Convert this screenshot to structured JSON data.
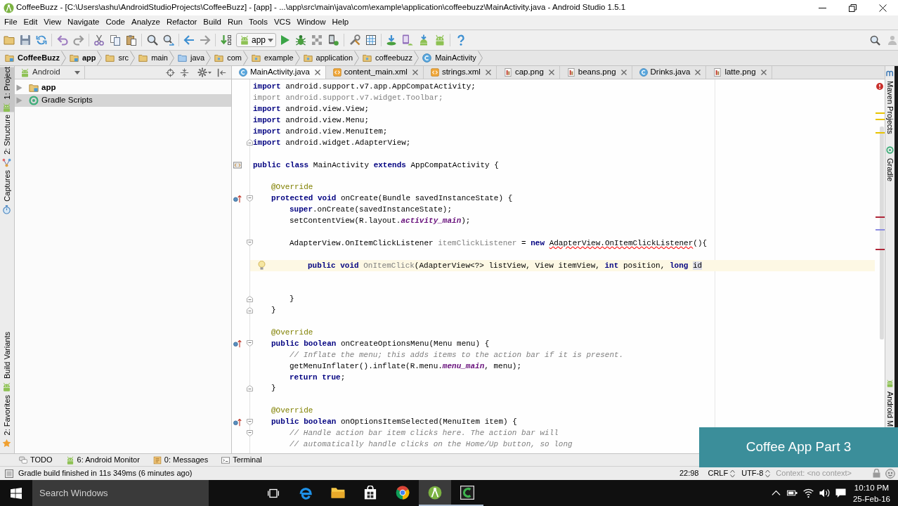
{
  "window": {
    "title": "CoffeeBuzz - [C:\\Users\\ashu\\AndroidStudioProjects\\CoffeeBuzz] - [app] - ...\\app\\src\\main\\java\\com\\example\\application\\coffeebuzz\\MainActivity.java - Android Studio 1.5.1"
  },
  "menu": [
    "File",
    "Edit",
    "View",
    "Navigate",
    "Code",
    "Analyze",
    "Refactor",
    "Build",
    "Run",
    "Tools",
    "VCS",
    "Window",
    "Help"
  ],
  "toolbar": {
    "run_configuration": "app"
  },
  "breadcrumbs": [
    {
      "label": "CoffeeBuzz",
      "kind": "project"
    },
    {
      "label": "app",
      "kind": "module"
    },
    {
      "label": "src",
      "kind": "folder"
    },
    {
      "label": "main",
      "kind": "folder"
    },
    {
      "label": "java",
      "kind": "source"
    },
    {
      "label": "com",
      "kind": "package"
    },
    {
      "label": "example",
      "kind": "package"
    },
    {
      "label": "application",
      "kind": "package"
    },
    {
      "label": "coffeebuzz",
      "kind": "package"
    },
    {
      "label": "MainActivity",
      "kind": "class"
    }
  ],
  "left_stripe": {
    "top": [
      {
        "label": "1: Project",
        "kind": "android",
        "selected": true
      },
      {
        "label": "2: Structure",
        "kind": "structure",
        "selected": false
      },
      {
        "label": "Captures",
        "kind": "captures",
        "selected": false
      }
    ],
    "bottom": [
      {
        "label": "Build Variants",
        "kind": "android",
        "selected": false
      },
      {
        "label": "2: Favorites",
        "kind": "favorites",
        "selected": false
      }
    ]
  },
  "project_panel": {
    "view": "Android",
    "tree": [
      {
        "label": "app",
        "kind": "module",
        "expanded": false,
        "selected": false
      },
      {
        "label": "Gradle Scripts",
        "kind": "gradle",
        "expanded": false,
        "selected": true
      }
    ]
  },
  "editor_tabs": [
    {
      "label": "MainActivity.java",
      "kind": "class",
      "selected": true
    },
    {
      "label": "content_main.xml",
      "kind": "xml",
      "selected": false
    },
    {
      "label": "strings.xml",
      "kind": "xml",
      "selected": false
    },
    {
      "label": "cap.png",
      "kind": "image",
      "selected": false
    },
    {
      "label": "beans.png",
      "kind": "image",
      "selected": false
    },
    {
      "label": "Drinks.java",
      "kind": "class",
      "selected": false
    },
    {
      "label": "latte.png",
      "kind": "image",
      "selected": false
    }
  ],
  "editor": {
    "lines": [
      {
        "current": false,
        "segments": [
          {
            "text": "import",
            "kind": "keyword"
          },
          {
            "text": " android.support.v7.app.AppCompatActivity;",
            "kind": "plain"
          }
        ]
      },
      {
        "current": false,
        "segments": [
          {
            "text": "import android.support.v7.widget.Toolbar;",
            "kind": "unused"
          }
        ]
      },
      {
        "current": false,
        "segments": [
          {
            "text": "import",
            "kind": "keyword"
          },
          {
            "text": " android.view.View;",
            "kind": "plain"
          }
        ]
      },
      {
        "current": false,
        "segments": [
          {
            "text": "import",
            "kind": "keyword"
          },
          {
            "text": " android.view.Menu;",
            "kind": "plain"
          }
        ]
      },
      {
        "current": false,
        "segments": [
          {
            "text": "import",
            "kind": "keyword"
          },
          {
            "text": " android.view.MenuItem;",
            "kind": "plain"
          }
        ]
      },
      {
        "current": false,
        "fold_marker": {
          "kind": "end"
        },
        "segments": [
          {
            "text": "import",
            "kind": "keyword"
          },
          {
            "text": " android.widget.AdapterView;",
            "kind": "plain"
          }
        ]
      },
      {
        "current": false
      },
      {
        "current": false,
        "gutter_icon": {
          "kind": "layout"
        },
        "segments": [
          {
            "text": "public class",
            "kind": "keyword"
          },
          {
            "text": " MainActivity ",
            "kind": "plain"
          },
          {
            "text": "extends",
            "kind": "keyword"
          },
          {
            "text": " AppCompatActivity {",
            "kind": "plain"
          }
        ],
        "children": [
          {
            "current": false
          },
          {
            "current": false,
            "segments": [
              {
                "text": "@Override",
                "kind": "annotation"
              }
            ]
          },
          {
            "current": false,
            "gutter_icon": {
              "kind": "override"
            },
            "fold_marker": {
              "kind": "start"
            },
            "segments": [
              {
                "text": "protected void",
                "kind": "keyword"
              },
              {
                "text": " onCreate(Bundle savedInstanceState) {",
                "kind": "plain"
              }
            ],
            "children": [
              {
                "current": false,
                "segments": [
                  {
                    "text": "super",
                    "kind": "keyword"
                  },
                  {
                    "text": ".onCreate(savedInstanceState);",
                    "kind": "plain"
                  }
                ]
              },
              {
                "current": false,
                "segments": [
                  {
                    "text": "setContentView(R.layout.",
                    "kind": "plain"
                  },
                  {
                    "text": "activity_main",
                    "kind": "field"
                  },
                  {
                    "text": ");",
                    "kind": "plain"
                  }
                ]
              },
              {
                "current": false
              },
              {
                "current": false,
                "fold_marker": {
                  "kind": "start"
                },
                "segments": [
                  {
                    "text": "AdapterView.OnItemClickListener ",
                    "kind": "plain"
                  },
                  {
                    "text": "itemClickListener",
                    "kind": "unused"
                  },
                  {
                    "text": " = ",
                    "kind": "plain"
                  },
                  {
                    "text": "new ",
                    "kind": "keyword"
                  },
                  {
                    "text": "AdapterView.OnItemClickListener",
                    "kind": "error"
                  },
                  {
                    "text": "(){",
                    "kind": "plain"
                  }
                ],
                "children": [
                  {
                    "current": false
                  },
                  {
                    "current": true,
                    "gutter_icon": {
                      "kind": "bulb"
                    },
                    "segments": [
                      {
                        "text": "public void ",
                        "kind": "keyword"
                      },
                      {
                        "text": "OnItemClick",
                        "kind": "unused"
                      },
                      {
                        "text": "(AdapterView<?> listView, View itemView, ",
                        "kind": "plain"
                      },
                      {
                        "text": "int",
                        "kind": "keyword"
                      },
                      {
                        "text": " position, ",
                        "kind": "plain"
                      },
                      {
                        "text": "long ",
                        "kind": "keyword"
                      },
                      {
                        "text": "id",
                        "kind": "highlighted"
                      }
                    ]
                  },
                  {
                    "current": false
                  },
                  {
                    "current": false
                  }
                ]
              },
              {
                "current": false,
                "fold_marker": {
                  "kind": "end"
                },
                "segments": [
                  {
                    "text": "}",
                    "kind": "plain"
                  }
                ]
              }
            ]
          },
          {
            "current": false,
            "fold_marker": {
              "kind": "end"
            },
            "segments": [
              {
                "text": "}",
                "kind": "plain"
              }
            ]
          },
          {
            "current": false
          },
          {
            "current": false,
            "segments": [
              {
                "text": "@Override",
                "kind": "annotation"
              }
            ]
          },
          {
            "current": false,
            "gutter_icon": {
              "kind": "override"
            },
            "fold_marker": {
              "kind": "start"
            },
            "segments": [
              {
                "text": "public boolean",
                "kind": "keyword"
              },
              {
                "text": " onCreateOptionsMenu(Menu menu) {",
                "kind": "plain"
              }
            ],
            "children": [
              {
                "current": false,
                "segments": [
                  {
                    "text": "// Inflate the menu; this adds items to the action bar if it is present.",
                    "kind": "comment"
                  }
                ]
              },
              {
                "current": false,
                "segments": [
                  {
                    "text": "getMenuInflater().inflate(R.menu.",
                    "kind": "plain"
                  },
                  {
                    "text": "menu_main",
                    "kind": "field"
                  },
                  {
                    "text": ", menu);",
                    "kind": "plain"
                  }
                ]
              },
              {
                "current": false,
                "segments": [
                  {
                    "text": "return true",
                    "kind": "keyword"
                  },
                  {
                    "text": ";",
                    "kind": "plain"
                  }
                ]
              }
            ]
          },
          {
            "current": false,
            "fold_marker": {
              "kind": "end"
            },
            "segments": [
              {
                "text": "}",
                "kind": "plain"
              }
            ]
          },
          {
            "current": false
          },
          {
            "current": false,
            "segments": [
              {
                "text": "@Override",
                "kind": "annotation"
              }
            ]
          },
          {
            "current": false,
            "gutter_icon": {
              "kind": "override"
            },
            "fold_marker": {
              "kind": "start"
            },
            "segments": [
              {
                "text": "public boolean",
                "kind": "keyword"
              },
              {
                "text": " onOptionsItemSelected(MenuItem item) {",
                "kind": "plain"
              }
            ],
            "children": [
              {
                "current": false,
                "fold_marker": {
                  "kind": "start"
                },
                "segments": [
                  {
                    "text": "// Handle action bar item clicks here. The action bar will",
                    "kind": "comment"
                  }
                ]
              },
              {
                "current": false,
                "segments": [
                  {
                    "text": "// automatically handle clicks on the Home/Up button, so long",
                    "kind": "comment"
                  }
                ]
              }
            ]
          }
        ]
      }
    ]
  },
  "right_stripe": {
    "top": [
      {
        "label": "Maven Projects",
        "kind": "maven"
      },
      {
        "label": "Gradle",
        "kind": "gradle"
      }
    ],
    "bottom": [
      {
        "label": "Android M",
        "kind": "android"
      }
    ]
  },
  "tool_tabs": [
    {
      "label": "TODO",
      "kind": "todo"
    },
    {
      "label": "6: Android Monitor",
      "kind": "android"
    },
    {
      "label": "0: Messages",
      "kind": "messages"
    },
    {
      "label": "Terminal",
      "kind": "terminal"
    }
  ],
  "status_bar": {
    "message": "Gradle build finished in 11s 349ms (6 minutes ago)",
    "position": "22:98",
    "line_separator": "CRLF",
    "encoding": "UTF-8",
    "context": "Context: <no context>"
  },
  "banner": {
    "text": "Coffee App Part 3"
  },
  "taskbar": {
    "search": {
      "placeholder": "Search Windows"
    },
    "apps": [
      {
        "kind": "browser",
        "selected": false,
        "running": false
      },
      {
        "kind": "files",
        "selected": false,
        "running": false
      },
      {
        "kind": "store",
        "selected": false,
        "running": false
      },
      {
        "kind": "chrome",
        "selected": false,
        "running": false
      },
      {
        "kind": "studio",
        "selected": true,
        "running": true
      },
      {
        "kind": "recorder",
        "selected": false,
        "running": true
      }
    ],
    "clock": {
      "time": "10:10 PM",
      "date": "25-Feb-16"
    }
  }
}
